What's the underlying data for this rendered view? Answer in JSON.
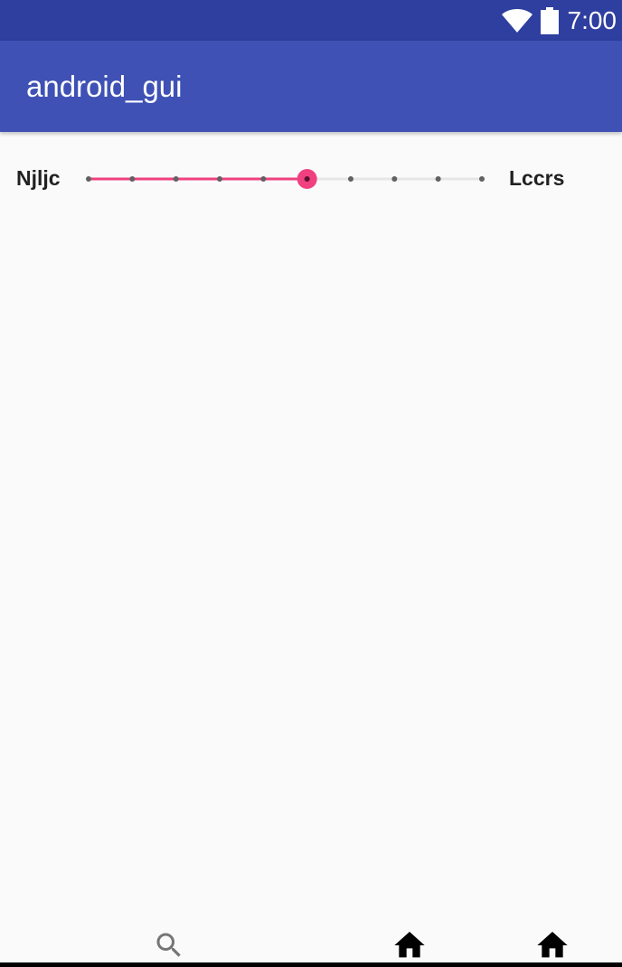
{
  "status_bar": {
    "time": "7:00",
    "icons": [
      "wifi-icon",
      "battery-icon"
    ],
    "background": "#2e3f9f"
  },
  "app_bar": {
    "title": "android_gui",
    "background": "#3f51b5"
  },
  "slider": {
    "left_label": "Njljc",
    "right_label": "Lccrs",
    "steps": 10,
    "selected_index": 5,
    "accent_color": "#f0407f"
  },
  "bottom_nav": {
    "items": [
      {
        "icon": "search-icon"
      },
      {
        "icon": "home-icon"
      },
      {
        "icon": "home-icon"
      }
    ]
  }
}
